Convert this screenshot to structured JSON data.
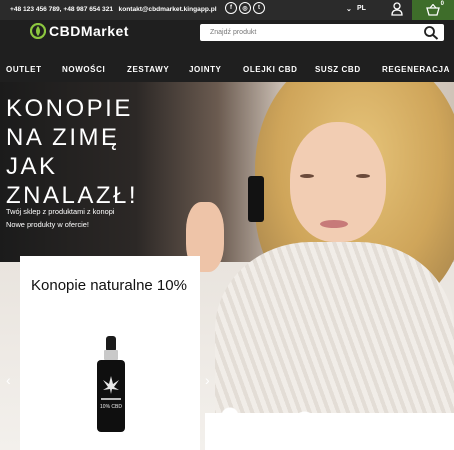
{
  "topbar": {
    "phones": "+48 123 456 789, +48 987 654 321",
    "email": "kontakt@cbdmarket.kingapp.pl",
    "social": [
      "facebook-icon",
      "instagram-icon",
      "twitter-icon"
    ],
    "language": "PL",
    "cart_count": "0"
  },
  "header": {
    "logo_text": "CBDMarket",
    "search_placeholder": "Znajdź produkt"
  },
  "nav": {
    "items": [
      "OUTLET",
      "NOWOŚCI",
      "ZESTAWY",
      "JOINTY",
      "OLEJKI CBD",
      "SUSZ CBD",
      "REGENERACJA"
    ]
  },
  "hero": {
    "title_lines": [
      "KONOPIE",
      "NA ZIMĘ",
      "JAK",
      "ZNALAZŁ!"
    ],
    "subtitle_1": "Twój sklep z produktami z konopi",
    "subtitle_2": "Nowe produkty w ofercie!"
  },
  "product_card": {
    "title": "Konopie naturalne 10%",
    "bottle_label": "10% CBD"
  },
  "colors": {
    "topbar_bg": "#2b2b2b",
    "cart_bg": "#3e6d2a",
    "brand_green": "#8cc63f",
    "header_bg": "#1f1f1f"
  }
}
